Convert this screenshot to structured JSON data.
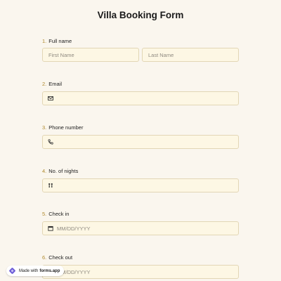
{
  "form": {
    "title": "Villa Booking Form",
    "questions": [
      {
        "number": "1.",
        "label": "Full name",
        "fields": [
          {
            "placeholder": "First Name"
          },
          {
            "placeholder": "Last Name"
          }
        ]
      },
      {
        "number": "2.",
        "label": "Email",
        "icon": "mail-icon",
        "value": ""
      },
      {
        "number": "3.",
        "label": "Phone number",
        "icon": "phone-icon",
        "value": ""
      },
      {
        "number": "4.",
        "label": "No. of nights",
        "icon": "people-icon",
        "value": ""
      },
      {
        "number": "5.",
        "label": "Check in",
        "icon": "calendar-icon",
        "placeholder": "MM/DD/YYYY"
      },
      {
        "number": "6.",
        "label": "Check out",
        "icon": "calendar-icon",
        "placeholder": "MM/DD/YYYY"
      }
    ]
  },
  "badge": {
    "made_with": "Made with",
    "brand": "forms.app"
  },
  "colors": {
    "background": "#faf6ee",
    "field_background": "#fdf7e4",
    "field_border": "#e2d6b5",
    "number_accent": "#b08a2e",
    "logo_accent": "#6b5bd6"
  }
}
